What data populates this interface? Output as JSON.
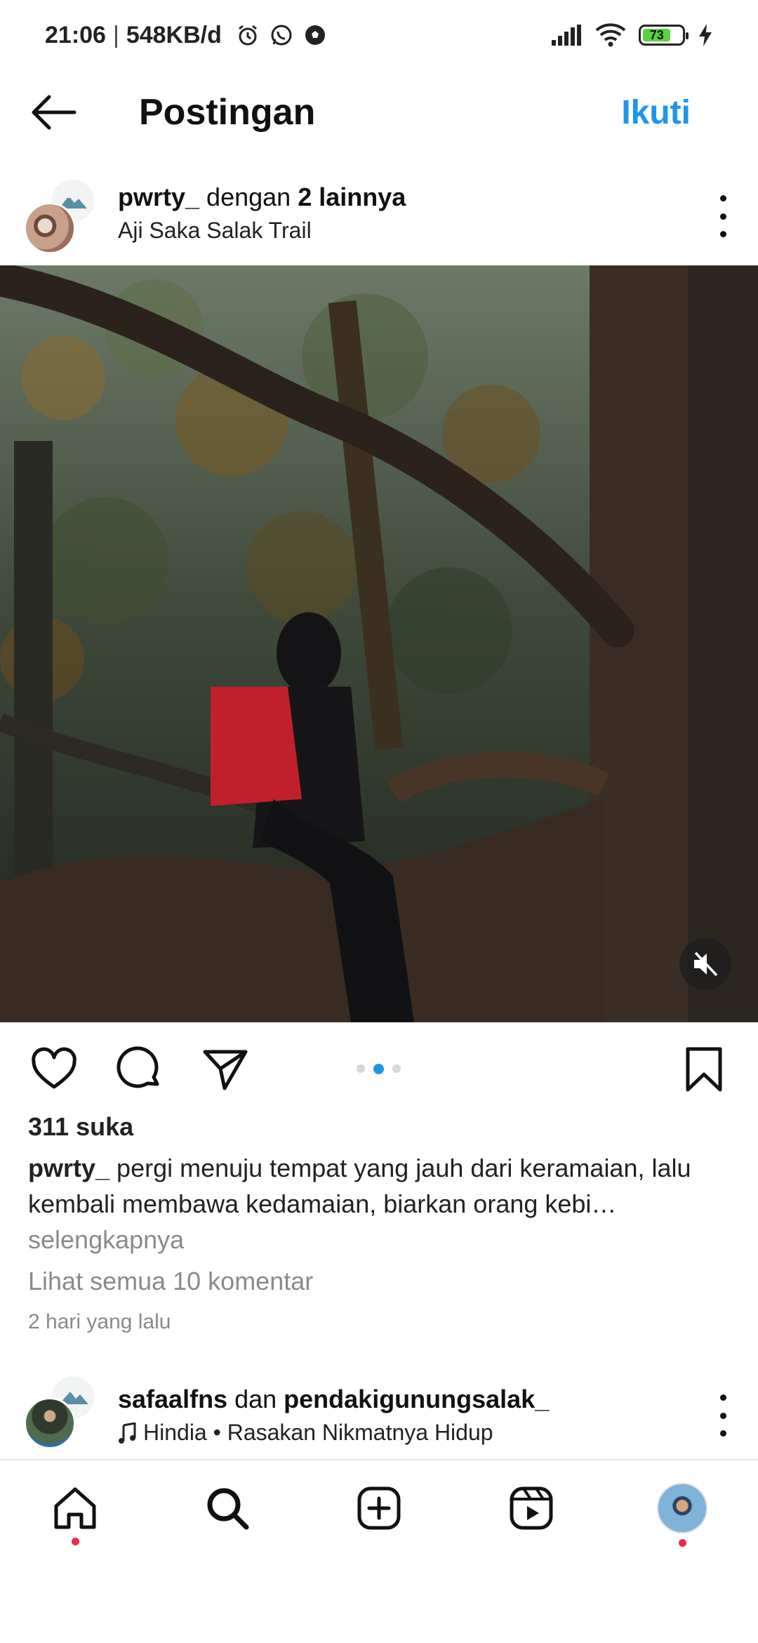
{
  "status_bar": {
    "time": "21:06",
    "separator": "|",
    "data_rate": "548KB/d",
    "battery_level": "73",
    "icons": [
      "alarm-icon",
      "whatsapp-icon",
      "soccer-ball-icon",
      "signal-icon",
      "wifi-icon",
      "battery-icon",
      "charging-icon"
    ]
  },
  "header": {
    "title": "Postingan",
    "follow_label": "Ikuti",
    "accent_color": "#1e96e8"
  },
  "post": {
    "username": "pwrty_",
    "collab_text": " dengan ",
    "collab_others": "2 lainnya",
    "location": "Aji Saka Salak Trail",
    "likes": "311 suka",
    "caption_user": "pwrty_",
    "caption_text": " pergi menuju tempat yang jauh dari keramaian, lalu kembali membawa kedamaian, biarkan orang kebi…",
    "see_more": "selengkapnya",
    "view_comments": "Lihat semua 10 komentar",
    "time_ago": "2 hari yang lalu",
    "carousel_index": 2,
    "carousel_count": 3
  },
  "next_post": {
    "user1": "safaalfns",
    "conjunction": " dan ",
    "user2": "pendakigunungsalak_",
    "audio": "Hindia • Rasakan Nikmatnya Hidup"
  },
  "bottom_nav": {
    "items": [
      "home-icon",
      "search-icon",
      "create-icon",
      "reels-icon",
      "profile-avatar"
    ],
    "notification_color": "#ef2a49"
  }
}
